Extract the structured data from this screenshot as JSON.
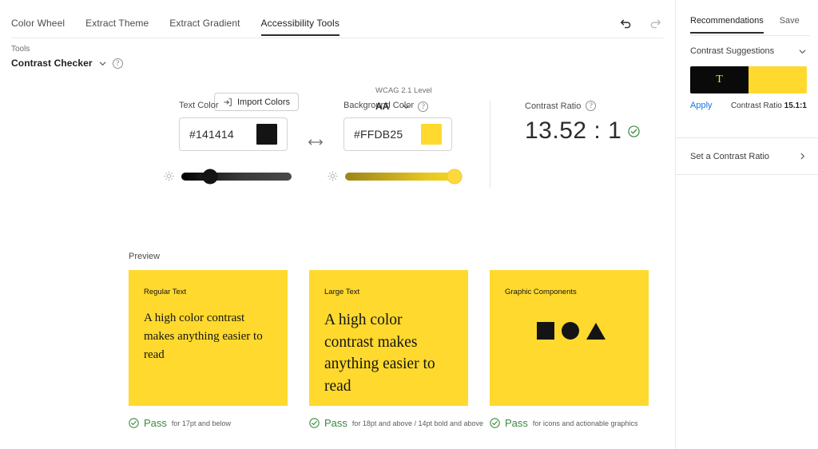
{
  "tabs": [
    {
      "label": "Color Wheel",
      "active": false
    },
    {
      "label": "Extract Theme",
      "active": false
    },
    {
      "label": "Extract Gradient",
      "active": false
    },
    {
      "label": "Accessibility Tools",
      "active": true
    }
  ],
  "history": {
    "undo_icon": "undo-icon",
    "redo_icon": "redo-icon"
  },
  "tools": {
    "caption": "Tools",
    "selected": "Contrast Checker",
    "chevron_icon": "chevron-down-icon",
    "help_icon": "help-icon",
    "help_glyph": "?"
  },
  "import": {
    "label": "Import Colors",
    "icon": "import-icon"
  },
  "wcag": {
    "caption": "WCAG 2.1 Level",
    "value": "AA",
    "chevron_icon": "chevron-down-icon",
    "help_glyph": "?"
  },
  "editor": {
    "text_color": {
      "label": "Text Color",
      "hex": "#141414",
      "swatch": "#141414"
    },
    "background_color": {
      "label": "Background Color",
      "hex": "#FFDB25",
      "swatch": "#FFD92E"
    },
    "swap_icon": "swap-horizontal-icon",
    "brightness_icon": "brightness-icon"
  },
  "contrast": {
    "caption": "Contrast Ratio",
    "help_glyph": "?",
    "value": "13.52 : 1",
    "status_icon": "check-circle-icon"
  },
  "preview": {
    "caption": "Preview",
    "cards": [
      {
        "kind": "Regular Text",
        "body": "A high color contrast makes anything easier to read",
        "type": "text"
      },
      {
        "kind": "Large Text",
        "body": "A high color contrast makes anything easier to read",
        "type": "text"
      },
      {
        "kind": "Graphic Components",
        "body": "",
        "type": "shapes"
      }
    ],
    "results": [
      {
        "status": "Pass",
        "note": "for 17pt and below"
      },
      {
        "status": "Pass",
        "note": "for 18pt and above / 14pt bold and above"
      },
      {
        "status": "Pass",
        "note": "for icons and actionable graphics"
      }
    ]
  },
  "sidebar": {
    "tabs": [
      {
        "label": "Recommendations",
        "active": true
      },
      {
        "label": "Save",
        "active": false
      }
    ],
    "suggestions": {
      "title": "Contrast Suggestions",
      "chevron_icon": "chevron-down-icon",
      "swatch_letter": "T",
      "swatch_fg": "#0a0a0a",
      "swatch_bg": "#FFD92E",
      "apply_label": "Apply",
      "ratio_label": "Contrast Ratio",
      "ratio_value": "15.1:1"
    },
    "set_ratio": {
      "label": "Set a Contrast Ratio",
      "chevron_icon": "chevron-right-icon"
    }
  },
  "colors": {
    "accent_link": "#1473e6",
    "pass_green": "#3a8a3f",
    "yellow": "#FFD92E",
    "black": "#141414"
  }
}
